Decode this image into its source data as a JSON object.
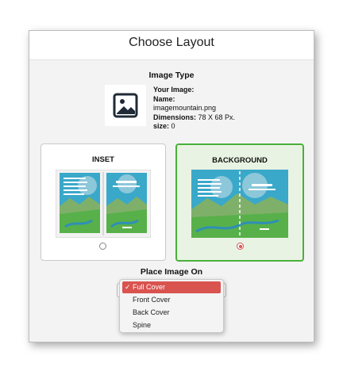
{
  "dialog": {
    "title": "Choose Layout",
    "image_type_label": "Image Type",
    "image_info": {
      "heading": "Your Image:",
      "name_label": "Name:",
      "name_value": "imagemountain.png",
      "dimensions_label": "Dimensions:",
      "dimensions_value": "78 X 68 Px.",
      "size_label": "size:",
      "size_value": "0"
    },
    "layouts": [
      {
        "label": "INSET",
        "selected": false
      },
      {
        "label": "BACKGROUND",
        "selected": true
      }
    ],
    "place_image_label": "Place Image On",
    "place_menu": {
      "options": [
        "Full Cover",
        "Front Cover",
        "Back Cover",
        "Spine"
      ],
      "selected": "Full Cover",
      "checkmark": "✓"
    }
  },
  "colors": {
    "selected_border": "#49b03b",
    "selected_bg": "#e8f3e3",
    "accent": "#d9534f",
    "sky": "#3aa8c9",
    "grass": "#58b04a"
  },
  "icons": {
    "image_placeholder": "image-icon"
  }
}
